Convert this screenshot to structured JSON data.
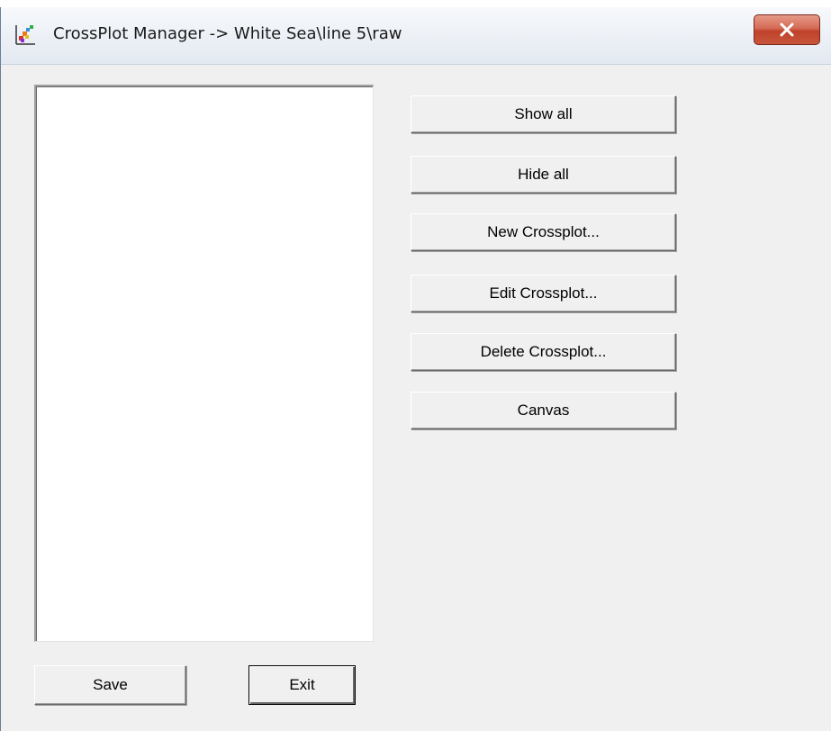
{
  "window": {
    "title": "CrossPlot Manager -> White Sea\\line 5\\raw",
    "icon": "crossplot-app-icon",
    "close_icon": "close-x-icon"
  },
  "list": {
    "items": []
  },
  "actions": {
    "show_all": "Show all",
    "hide_all": "Hide all",
    "new_crossplot": "New Crossplot...",
    "edit_crossplot": "Edit Crossplot...",
    "delete_crossplot": "Delete Crossplot...",
    "canvas": "Canvas"
  },
  "footer": {
    "save": "Save",
    "exit": "Exit"
  },
  "colors": {
    "window_bg": "#f0f0f0",
    "close_button": "#c8553c"
  }
}
